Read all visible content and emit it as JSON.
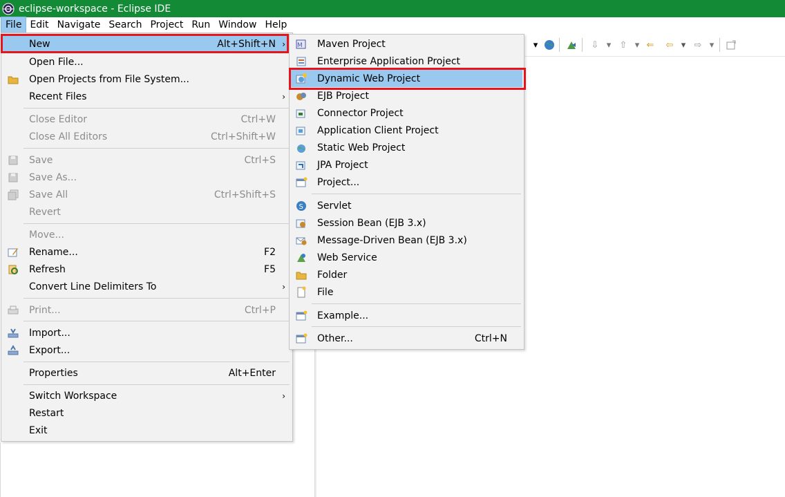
{
  "window": {
    "title": "eclipse-workspace - Eclipse IDE"
  },
  "menubar": [
    {
      "label": "File",
      "active": true
    },
    {
      "label": "Edit"
    },
    {
      "label": "Navigate"
    },
    {
      "label": "Search"
    },
    {
      "label": "Project"
    },
    {
      "label": "Run"
    },
    {
      "label": "Window"
    },
    {
      "label": "Help"
    }
  ],
  "file_menu": {
    "items": [
      {
        "label": "New",
        "shortcut": "Alt+Shift+N",
        "submenu": true,
        "highlighted": true,
        "icon": "none"
      },
      {
        "label": "Open File...",
        "icon": "none"
      },
      {
        "label": "Open Projects from File System...",
        "icon": "folder-icon"
      },
      {
        "label": "Recent Files",
        "submenu": true,
        "icon": "none"
      },
      {
        "label": "Close Editor",
        "shortcut": "Ctrl+W",
        "disabled": true
      },
      {
        "label": "Close All Editors",
        "shortcut": "Ctrl+Shift+W",
        "disabled": true
      },
      {
        "label": "Save",
        "shortcut": "Ctrl+S",
        "disabled": true,
        "icon": "save-icon"
      },
      {
        "label": "Save As...",
        "disabled": true,
        "icon": "save-as-icon"
      },
      {
        "label": "Save All",
        "shortcut": "Ctrl+Shift+S",
        "disabled": true,
        "icon": "save-all-icon"
      },
      {
        "label": "Revert",
        "disabled": true
      },
      {
        "label": "Move...",
        "disabled": true
      },
      {
        "label": "Rename...",
        "shortcut": "F2",
        "icon": "rename-icon"
      },
      {
        "label": "Refresh",
        "shortcut": "F5",
        "icon": "refresh-icon"
      },
      {
        "label": "Convert Line Delimiters To",
        "submenu": true
      },
      {
        "label": "Print...",
        "shortcut": "Ctrl+P",
        "disabled": true,
        "icon": "print-icon"
      },
      {
        "label": "Import...",
        "icon": "import-icon"
      },
      {
        "label": "Export...",
        "icon": "export-icon"
      },
      {
        "label": "Properties",
        "shortcut": "Alt+Enter"
      },
      {
        "label": "Switch Workspace",
        "submenu": true
      },
      {
        "label": "Restart"
      },
      {
        "label": "Exit"
      }
    ]
  },
  "new_menu": {
    "items": [
      {
        "label": "Maven Project",
        "icon": "maven-project-icon"
      },
      {
        "label": "Enterprise Application Project",
        "icon": "enterprise-app-project-icon"
      },
      {
        "label": "Dynamic Web Project",
        "icon": "dynamic-web-project-icon",
        "highlighted": true
      },
      {
        "label": "EJB Project",
        "icon": "ejb-project-icon"
      },
      {
        "label": "Connector Project",
        "icon": "connector-project-icon"
      },
      {
        "label": "Application Client Project",
        "icon": "app-client-project-icon"
      },
      {
        "label": "Static Web Project",
        "icon": "static-web-project-icon"
      },
      {
        "label": "JPA Project",
        "icon": "jpa-project-icon"
      },
      {
        "label": "Project...",
        "icon": "project-icon"
      },
      {
        "label": "Servlet",
        "icon": "servlet-icon"
      },
      {
        "label": "Session Bean (EJB 3.x)",
        "icon": "session-bean-icon"
      },
      {
        "label": "Message-Driven Bean (EJB 3.x)",
        "icon": "message-driven-bean-icon"
      },
      {
        "label": "Web Service",
        "icon": "web-service-icon"
      },
      {
        "label": "Folder",
        "icon": "folder-icon"
      },
      {
        "label": "File",
        "icon": "file-icon"
      },
      {
        "label": "Example...",
        "icon": "example-icon"
      },
      {
        "label": "Other...",
        "shortcut": "Ctrl+N",
        "icon": "other-wizard-icon"
      }
    ]
  },
  "colors": {
    "titlebar": "#138a36",
    "highlight": "#99c9ef",
    "annotation": "#e8141b"
  }
}
